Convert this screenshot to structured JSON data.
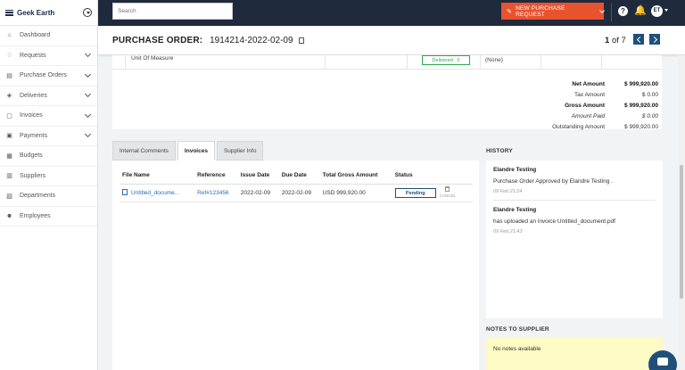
{
  "brand": {
    "name": "Geek Earth"
  },
  "sidebar": {
    "items": [
      {
        "label": "Dashboard",
        "icon": "home-icon",
        "glyph": "⌂",
        "expandable": false
      },
      {
        "label": "Requests",
        "icon": "bell-outline-icon",
        "glyph": "♢",
        "expandable": true
      },
      {
        "label": "Purchase Orders",
        "icon": "document-icon",
        "glyph": "▤",
        "expandable": true
      },
      {
        "label": "Deliveries",
        "icon": "box-icon",
        "glyph": "◈",
        "expandable": true
      },
      {
        "label": "Invoices",
        "icon": "invoice-icon",
        "glyph": "▢",
        "expandable": true
      },
      {
        "label": "Payments",
        "icon": "payment-icon",
        "glyph": "▣",
        "expandable": true
      },
      {
        "label": "Budgets",
        "icon": "budget-icon",
        "glyph": "▦",
        "expandable": false
      },
      {
        "label": "Suppliers",
        "icon": "building-icon",
        "glyph": "▥",
        "expandable": false
      },
      {
        "label": "Departments",
        "icon": "departments-icon",
        "glyph": "▧",
        "expandable": false
      },
      {
        "label": "Employees",
        "icon": "users-icon",
        "glyph": "☻",
        "expandable": false
      }
    ]
  },
  "topbar": {
    "search_placeholder": "Search",
    "new_po_label": "NEW PURCHASE REQUEST",
    "help_glyph": "?",
    "bell_glyph": "🔔",
    "avatar_initials": "ET"
  },
  "header": {
    "title_label": "PURCHASE ORDER:",
    "po_number": "1914214-2022-02-09",
    "pager_current": "1",
    "pager_text": "of 7"
  },
  "summary": {
    "unit_of_measure": "Unit Of Measure",
    "delivered_badge": "Delivered : 0",
    "none_value": "(None)",
    "totals": [
      {
        "label": "Net Amount",
        "value": "$ 999,920.00",
        "style": "bold"
      },
      {
        "label": "Tax Amount",
        "value": "$ 0.00",
        "style": "normal"
      },
      {
        "label": "Gross Amount",
        "value": "$ 999,920.00",
        "style": "bold"
      },
      {
        "label": "Amount Paid",
        "value": "$ 0.00",
        "style": "italic"
      },
      {
        "label": "Outstanding Amount",
        "value": "$ 999,920.00",
        "style": "normal"
      }
    ]
  },
  "tabs": [
    {
      "label": "Internal Comments",
      "active": false
    },
    {
      "label": "Invoices",
      "active": true
    },
    {
      "label": "Supplier Info",
      "active": false
    }
  ],
  "invoices": {
    "columns": [
      "File Name",
      "Reference",
      "Issue Date",
      "Due Date",
      "Total Gross Amount",
      "Status"
    ],
    "rows": [
      {
        "file_name": "Untitled_docume...",
        "reference": "Ref#123456",
        "issue_date": "2022-02-09",
        "due_date": "2022-02-09",
        "total": "USD 999,920.00",
        "status": "Pending",
        "cancel_label": "CANCEL"
      }
    ]
  },
  "history": {
    "title": "HISTORY",
    "items": [
      {
        "who": "Elandre Testing",
        "what": "Purchase Order Approved by Elandre Testing .",
        "when": "09 Feb 21:24"
      },
      {
        "who": "Elandre Testing",
        "what": "has uploaded an invoice Untitled_document.pdf",
        "when": "09 Feb 21:43"
      }
    ]
  },
  "notes": {
    "title": "NOTES TO SUPPLIER",
    "text": "No notes available"
  }
}
